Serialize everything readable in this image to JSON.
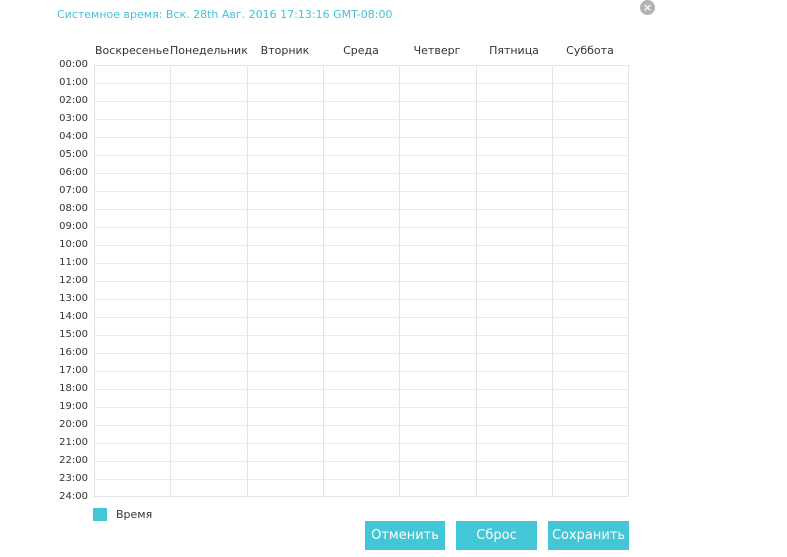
{
  "header": {
    "system_time": "Системное время: Вск. 28th Авг. 2016 17:13:16 GMT-08:00",
    "close_glyph": "×"
  },
  "schedule": {
    "days": [
      "Воскресенье",
      "Понедельник",
      "Вторник",
      "Среда",
      "Четверг",
      "Пятница",
      "Суббота"
    ],
    "hours": [
      "00:00",
      "01:00",
      "02:00",
      "03:00",
      "04:00",
      "05:00",
      "06:00",
      "07:00",
      "08:00",
      "09:00",
      "10:00",
      "11:00",
      "12:00",
      "13:00",
      "14:00",
      "15:00",
      "16:00",
      "17:00",
      "18:00",
      "19:00",
      "20:00",
      "21:00",
      "22:00",
      "23:00",
      "24:00"
    ],
    "selected_slots": []
  },
  "legend": {
    "label": "Время",
    "color": "#43c6d6"
  },
  "buttons": {
    "cancel": "Отменить",
    "reset": "Сброс",
    "save": "Сохранить"
  },
  "colors": {
    "accent": "#43c6d6",
    "title": "#43c2d9"
  }
}
